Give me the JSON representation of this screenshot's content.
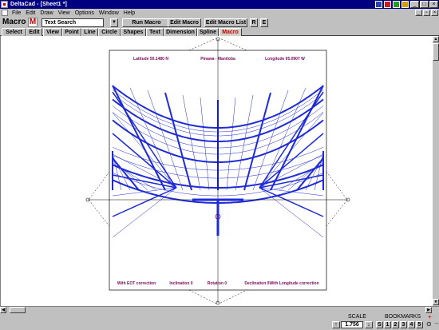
{
  "window": {
    "title": "DeltaCad - [Sheet1 *]"
  },
  "menu": [
    "File",
    "Edit",
    "Draw",
    "View",
    "Options",
    "Window",
    "Help"
  ],
  "toolbar": {
    "macro_label": "Macro",
    "macro_icon_letter": "M",
    "command_value": "Text Search",
    "run_macro": "Run Macro",
    "edit_macro": "Edit Macro",
    "edit_macro_list": "Edit Macro List",
    "r_btn": "R",
    "e_btn": "E"
  },
  "tabs": [
    "Select",
    "Edit",
    "View",
    "Point",
    "Line",
    "Circle",
    "Shapes",
    "Text",
    "Dimension",
    "Spline",
    "Macro"
  ],
  "active_tab": "Macro",
  "drawing": {
    "latitude": "Latitude 50.1480 N",
    "location": "Pinawa - Manitoba",
    "longitude": "Longitude 95.0907 W",
    "eot": "With EOT correction",
    "inclination": "Inclination 0",
    "rotation": "Rotation 0",
    "declination": "Declination 0With Longitude correction",
    "line_color": "#1f2bd6",
    "label_color": "#7a0a5a"
  },
  "status": {
    "scale_label": "SCALE",
    "scale_value": "1.756",
    "bookmarks_label": "BOOKMARKS",
    "bookmarks": [
      "S",
      "1",
      "2",
      "3",
      "4",
      "5"
    ]
  }
}
